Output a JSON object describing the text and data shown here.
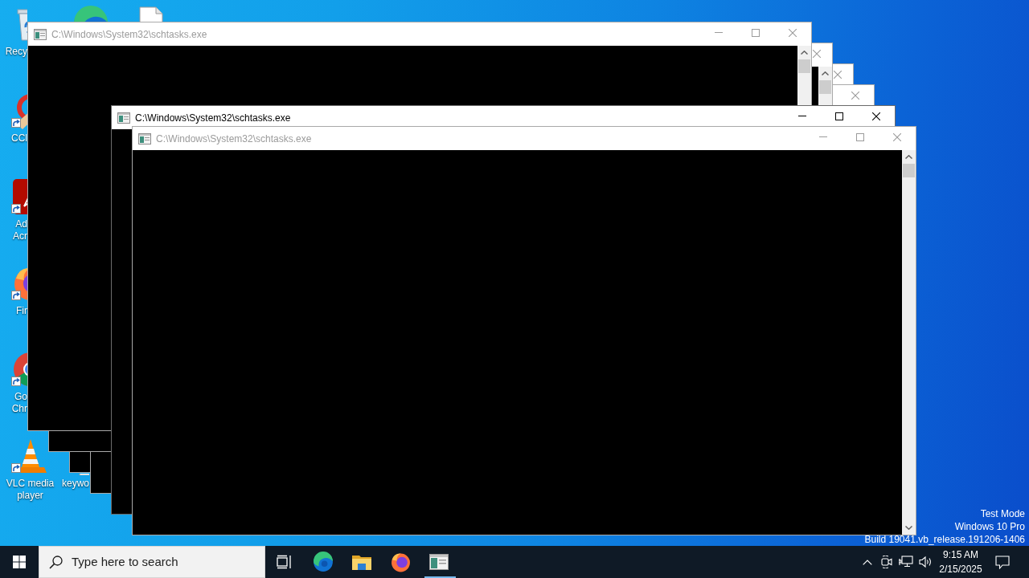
{
  "desktop": {
    "icons": [
      {
        "kind": "bin",
        "label": "Recy",
        "shortcut": false
      },
      {
        "kind": "swirl",
        "shortcut": false
      },
      {
        "kind": "page",
        "shortcut": false
      },
      {
        "kind": "brush",
        "label": "CCl",
        "shortcut": true
      },
      {
        "kind": "tile",
        "label": "Ad Acr",
        "shortcut": true
      },
      {
        "kind": "fox",
        "label": "Fir",
        "shortcut": true
      },
      {
        "kind": "wheel",
        "label": "Go Chr",
        "shortcut": true
      },
      {
        "kind": "cone",
        "label": "VLC media player",
        "shortcut": true
      },
      {
        "kind": "page",
        "label": "keywo",
        "shortcut": false
      }
    ]
  },
  "windows": [
    {
      "title": "C:\\Windows\\System32\\schtasks.exe",
      "active": false,
      "buttons": [
        {
          "kind": "minimize"
        },
        {
          "kind": "maximize"
        },
        {
          "kind": "close"
        }
      ],
      "scrollbar": [
        {
          "kind": "up"
        },
        {
          "kind": "thumb"
        }
      ]
    },
    {
      "active": false,
      "buttons": [
        {
          "kind": "close"
        }
      ],
      "scrollbar": [
        {
          "kind": "up"
        },
        {
          "kind": "thumb"
        }
      ]
    },
    {
      "active": false,
      "buttons": [
        {
          "kind": "close"
        }
      ]
    },
    {
      "active": false,
      "buttons": [
        {
          "kind": "close"
        }
      ]
    },
    {
      "title": "C:\\Windows\\System32\\schtasks.exe",
      "active": true,
      "buttons": [
        {
          "kind": "minimize"
        },
        {
          "kind": "maximize"
        },
        {
          "kind": "close"
        }
      ]
    },
    {
      "title": "C:\\Windows\\System32\\schtasks.exe",
      "active": false,
      "buttons": [
        {
          "kind": "minimize"
        },
        {
          "kind": "maximize"
        },
        {
          "kind": "close"
        }
      ],
      "scrollbar": [
        {
          "kind": "up"
        },
        {
          "kind": "thumb"
        },
        {
          "kind": "down"
        }
      ]
    }
  ],
  "notice": [
    "Test Mode",
    "Windows 10 Pro",
    "Build 19041.vb_release.191206-1406"
  ],
  "taskbar": {
    "search": {
      "placeholder": "Type here to search"
    },
    "apps": [
      {
        "kind": "task-view",
        "open": false
      },
      {
        "kind": "swirl",
        "open": false
      },
      {
        "kind": "folder",
        "open": false
      },
      {
        "kind": "fox",
        "open": false
      },
      {
        "kind": "console",
        "open": true
      }
    ],
    "clock": {
      "time": "9:15 AM",
      "date": "2/15/2025"
    }
  }
}
